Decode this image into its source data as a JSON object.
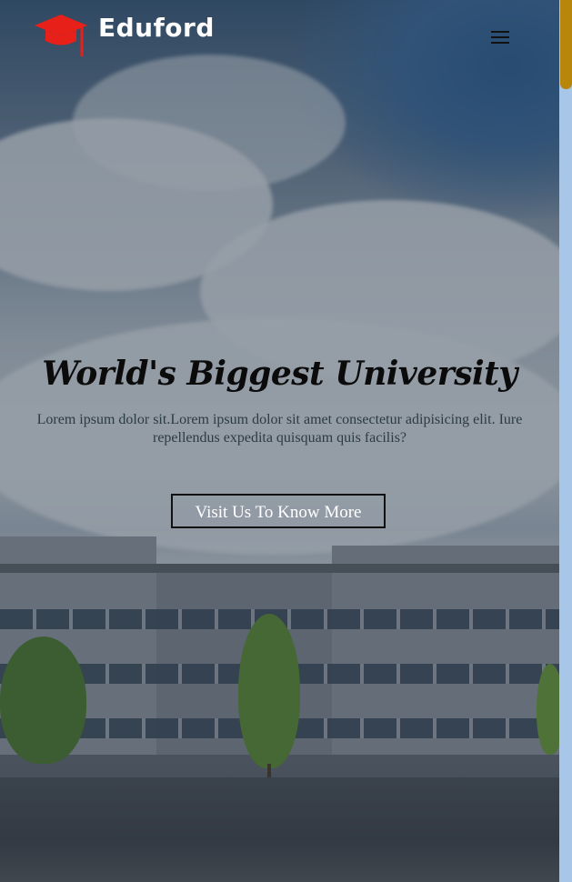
{
  "header": {
    "brand": "Eduford",
    "logo_icon": "graduation-cap-icon",
    "menu_icon": "hamburger-menu-icon"
  },
  "hero": {
    "title": "World's Biggest University",
    "description": "Lorem ipsum dolor sit.Lorem ipsum dolor sit amet consectetur adipisicing elit. Iure repellendus expedita quisquam quis facilis?",
    "cta_label": "Visit Us To Know More"
  },
  "colors": {
    "brand_red": "#e8201a",
    "scroll_track": "#a8c6e8",
    "scroll_thumb": "#b8860b"
  }
}
